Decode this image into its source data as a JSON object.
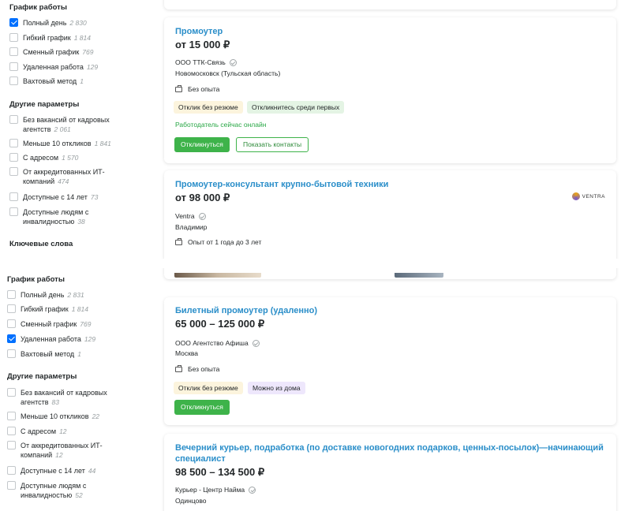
{
  "top": {
    "schedule": {
      "title": "График работы",
      "items": [
        {
          "label": "Полный день",
          "count": "2 830",
          "checked": true
        },
        {
          "label": "Гибкий график",
          "count": "1 814",
          "checked": false
        },
        {
          "label": "Сменный график",
          "count": "769",
          "checked": false
        },
        {
          "label": "Удаленная работа",
          "count": "129",
          "checked": false
        },
        {
          "label": "Вахтовый метод",
          "count": "1",
          "checked": false
        }
      ]
    },
    "other": {
      "title": "Другие параметры",
      "items": [
        {
          "label": "Без вакансий от кадровых агентств",
          "count": "2 061"
        },
        {
          "label": "Меньше 10 откликов",
          "count": "1 841"
        },
        {
          "label": "С адресом",
          "count": "1 570"
        },
        {
          "label": "От аккредитованных ИТ-компаний",
          "count": "474"
        },
        {
          "label": "Доступные с 14 лет",
          "count": "73"
        },
        {
          "label": "Доступные людям с инвалидностью",
          "count": "38"
        }
      ]
    },
    "keywords_title": "Ключевые слова",
    "vacancies": [
      {
        "title": "Промоутер",
        "salary": "от 15 000 ₽",
        "employer": "ООО ТТК-Связь",
        "city": "Новомосковск (Тульская область)",
        "experience": "Без опыта",
        "tags": [
          "Отклик без резюме",
          "Откликнитесь среди первых"
        ],
        "online": "Работодатель сейчас онлайн",
        "respond": "Откликнуться",
        "contacts": "Показать контакты"
      },
      {
        "title": "Промоутер-консультант крупно-бытовой техники",
        "salary": "от 98 000 ₽",
        "employer": "Ventra",
        "city": "Владимир",
        "experience": "Опыт от 1 года до 3 лет",
        "logo": "VENTRA"
      }
    ]
  },
  "bottom": {
    "schedule": {
      "title": "График работы",
      "items": [
        {
          "label": "Полный день",
          "count": "2 831",
          "checked": false
        },
        {
          "label": "Гибкий график",
          "count": "1 814",
          "checked": false
        },
        {
          "label": "Сменный график",
          "count": "769",
          "checked": false
        },
        {
          "label": "Удаленная работа",
          "count": "129",
          "checked": true
        },
        {
          "label": "Вахтовый метод",
          "count": "1",
          "checked": false
        }
      ]
    },
    "other": {
      "title": "Другие параметры",
      "items": [
        {
          "label": "Без вакансий от кадровых агентств",
          "count": "83"
        },
        {
          "label": "Меньше 10 откликов",
          "count": "22"
        },
        {
          "label": "С адресом",
          "count": "12"
        },
        {
          "label": "От аккредитованных ИТ-компаний",
          "count": "12"
        },
        {
          "label": "Доступные с 14 лет",
          "count": "44"
        },
        {
          "label": "Доступные людям с инвалидностью",
          "count": "52"
        }
      ]
    },
    "vacancies": [
      {
        "title": "Билетный промоутер (удаленно)",
        "salary": "65 000 – 125 000 ₽",
        "employer": "ООО Агентство Афиша",
        "city": "Москва",
        "experience": "Без опыта",
        "tags": [
          "Отклик без резюме",
          "Можно из дома"
        ],
        "respond": "Откликнуться"
      },
      {
        "title": "Вечерний курьер, подработка (по доставке новогодних подарков, ценных-посылок)—начинающий специалист",
        "salary": "98 500 – 134 500 ₽",
        "employer": "Курьер - Центр Найма",
        "city": "Одинцово"
      }
    ]
  },
  "colors": {
    "link": "#2a8ec9",
    "green_button": "#3eb34a",
    "checkbox_checked": "#0070ff",
    "online": "#28a745"
  }
}
